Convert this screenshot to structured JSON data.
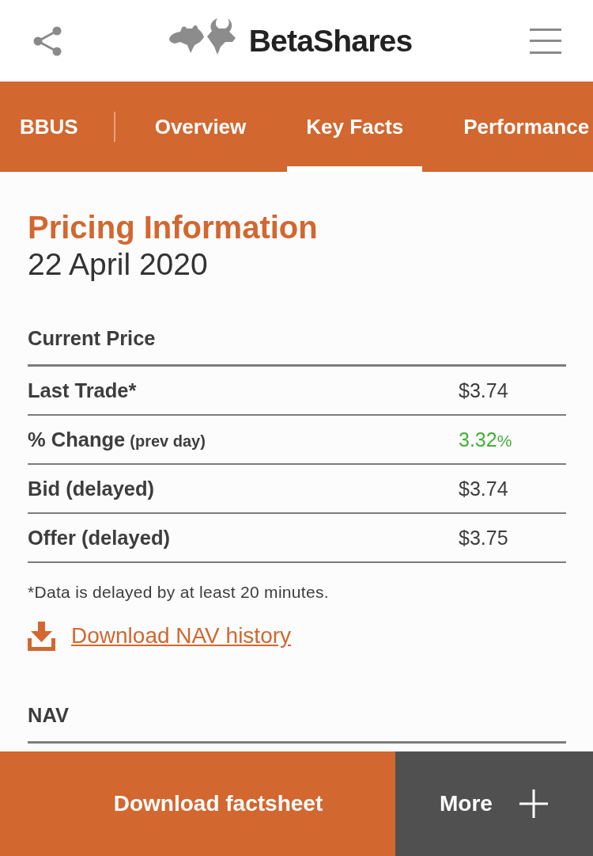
{
  "header": {
    "logo": {
      "text": "BetaShares"
    }
  },
  "nav": {
    "fund_code": "BBUS",
    "tabs": [
      {
        "label": "Overview",
        "selected": false
      },
      {
        "label": "Key Facts",
        "selected": true
      },
      {
        "label": "Performance",
        "selected": false
      }
    ]
  },
  "pricing": {
    "title": "Pricing Information",
    "date": "22 April 2020",
    "current_price": {
      "heading": "Current Price",
      "rows": [
        {
          "label": "Last Trade*",
          "value": "$3.74"
        },
        {
          "label": "% Change",
          "note": "(prev day)",
          "value": "3.32",
          "unit": "%",
          "positive": true
        },
        {
          "label": "Bid (delayed)",
          "value": "$3.74"
        },
        {
          "label": "Offer (delayed)",
          "value": "$3.75"
        }
      ]
    },
    "footnote": "*Data is delayed by at least 20 minutes.",
    "download_link": "Download NAV history",
    "nav_section": {
      "heading": "NAV"
    }
  },
  "footer": {
    "buttons": [
      {
        "kind": "primary",
        "label": "Download factsheet"
      },
      {
        "kind": "more",
        "label": "More"
      }
    ]
  }
}
